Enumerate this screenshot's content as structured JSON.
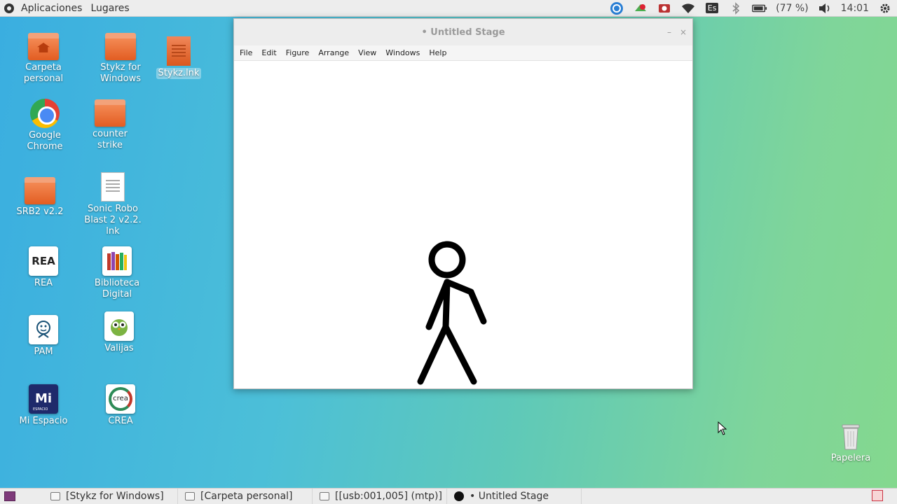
{
  "top_panel": {
    "applications": "Aplicaciones",
    "places": "Lugares",
    "battery": "(77 %)",
    "clock": "14:01",
    "keyboard_layout": "Es"
  },
  "desktop": {
    "icons": [
      {
        "label": "Carpeta personal",
        "icon": "home-folder-icon"
      },
      {
        "label": "Stykz for Windows",
        "icon": "folder-icon"
      },
      {
        "label": "Stykz.lnk",
        "icon": "document-icon"
      },
      {
        "label": "Google Chrome",
        "icon": "chrome-icon"
      },
      {
        "label": "counter strike",
        "icon": "folder-icon"
      },
      {
        "label": "SRB2 v2.2",
        "icon": "folder-icon"
      },
      {
        "label": "Sonic Robo Blast 2 v2.2. lnk",
        "icon": "text-file-icon"
      },
      {
        "label": "REA",
        "icon": "rea-icon"
      },
      {
        "label": "Biblioteca Digital",
        "icon": "books-icon"
      },
      {
        "label": "PAM",
        "icon": "pam-icon"
      },
      {
        "label": "Valijas",
        "icon": "owl-icon"
      },
      {
        "label": "Mi Espacio",
        "icon": "mi-espacio-icon"
      },
      {
        "label": "CREA",
        "icon": "crea-icon"
      },
      {
        "label": "Papelera",
        "icon": "trash-icon"
      }
    ],
    "rea_text": "REA",
    "mi_text": "Mi",
    "mi_sub": "ESPACIO",
    "crea_text": "crea"
  },
  "window": {
    "title": "• Untitled Stage",
    "menu": [
      "File",
      "Edit",
      "Figure",
      "Arrange",
      "View",
      "Windows",
      "Help"
    ]
  },
  "taskbar": {
    "tasks": [
      {
        "label": "[Stykz for Windows]"
      },
      {
        "label": "[Carpeta personal]"
      },
      {
        "label": "[[usb:001,005] (mtp)]"
      },
      {
        "label": "• Untitled Stage"
      }
    ]
  }
}
